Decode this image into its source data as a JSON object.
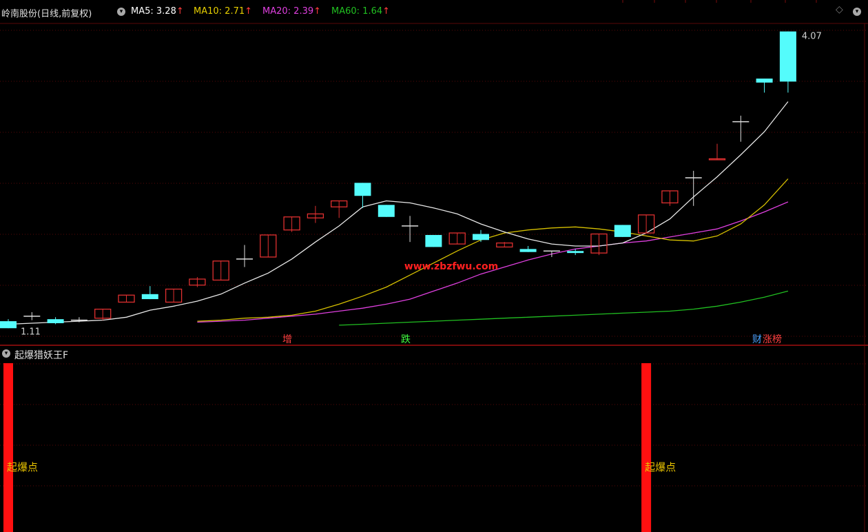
{
  "header": {
    "title": "岭南股份(日线,前复权)",
    "ma": [
      {
        "label": "MA5:",
        "value": "3.28",
        "color": "#ffffff"
      },
      {
        "label": "MA10:",
        "value": "2.71",
        "color": "#e8d000"
      },
      {
        "label": "MA20:",
        "value": "2.39",
        "color": "#e040e0"
      },
      {
        "label": "MA60:",
        "value": "1.64",
        "color": "#21c021"
      }
    ]
  },
  "price": {
    "high_label": "4.07",
    "low_label": "1.11",
    "watermark": "www.zbzfwu.com",
    "markers": [
      {
        "text": "增",
        "color": "#ff4040"
      },
      {
        "text": "跌",
        "color": "#40ff40"
      },
      {
        "text": "财",
        "color": "#4aa3ff"
      },
      {
        "text": "涨榜",
        "color": "#ff4040"
      }
    ]
  },
  "chart_data": {
    "type": "candlestick",
    "series_name": "岭南股份",
    "ylim": [
      1.05,
      4.15
    ],
    "candles": [
      {
        "o": 1.18,
        "h": 1.2,
        "l": 1.11,
        "c": 1.11
      },
      {
        "o": 1.23,
        "h": 1.27,
        "l": 1.19,
        "c": 1.23
      },
      {
        "o": 1.2,
        "h": 1.22,
        "l": 1.15,
        "c": 1.16
      },
      {
        "o": 1.19,
        "h": 1.22,
        "l": 1.17,
        "c": 1.19
      },
      {
        "o": 1.21,
        "h": 1.3,
        "l": 1.19,
        "c": 1.3
      },
      {
        "o": 1.37,
        "h": 1.44,
        "l": 1.37,
        "c": 1.44
      },
      {
        "o": 1.45,
        "h": 1.53,
        "l": 1.4,
        "c": 1.4
      },
      {
        "o": 1.37,
        "h": 1.5,
        "l": 1.37,
        "c": 1.5
      },
      {
        "o": 1.54,
        "h": 1.62,
        "l": 1.52,
        "c": 1.6
      },
      {
        "o": 1.59,
        "h": 1.78,
        "l": 1.59,
        "c": 1.78
      },
      {
        "o": 1.8,
        "h": 1.94,
        "l": 1.72,
        "c": 1.8
      },
      {
        "o": 1.82,
        "h": 2.04,
        "l": 1.82,
        "c": 2.04
      },
      {
        "o": 2.09,
        "h": 2.22,
        "l": 2.07,
        "c": 2.22
      },
      {
        "o": 2.21,
        "h": 2.33,
        "l": 2.16,
        "c": 2.25
      },
      {
        "o": 2.32,
        "h": 2.38,
        "l": 2.21,
        "c": 2.38
      },
      {
        "o": 2.56,
        "h": 2.56,
        "l": 2.31,
        "c": 2.43
      },
      {
        "o": 2.34,
        "h": 2.34,
        "l": 2.22,
        "c": 2.22
      },
      {
        "o": 2.13,
        "h": 2.23,
        "l": 1.97,
        "c": 2.13
      },
      {
        "o": 2.04,
        "h": 2.04,
        "l": 1.92,
        "c": 1.92
      },
      {
        "o": 1.95,
        "h": 2.06,
        "l": 1.95,
        "c": 2.06
      },
      {
        "o": 2.05,
        "h": 2.09,
        "l": 1.97,
        "c": 1.99
      },
      {
        "o": 1.92,
        "h": 1.97,
        "l": 1.92,
        "c": 1.96
      },
      {
        "o": 1.9,
        "h": 1.93,
        "l": 1.87,
        "c": 1.87
      },
      {
        "o": 1.88,
        "h": 1.88,
        "l": 1.82,
        "c": 1.88
      },
      {
        "o": 1.88,
        "h": 1.9,
        "l": 1.84,
        "c": 1.86
      },
      {
        "o": 1.86,
        "h": 2.05,
        "l": 1.84,
        "c": 2.05
      },
      {
        "o": 2.14,
        "h": 2.14,
        "l": 2.02,
        "c": 2.02
      },
      {
        "o": 2.06,
        "h": 2.24,
        "l": 2.06,
        "c": 2.24
      },
      {
        "o": 2.36,
        "h": 2.48,
        "l": 2.33,
        "c": 2.48
      },
      {
        "o": 2.61,
        "h": 2.68,
        "l": 2.33,
        "c": 2.61
      },
      {
        "o": 2.79,
        "h": 2.95,
        "l": 2.79,
        "c": 2.8
      },
      {
        "o": 3.17,
        "h": 3.23,
        "l": 2.97,
        "c": 3.17
      },
      {
        "o": 3.6,
        "h": 3.6,
        "l": 3.46,
        "c": 3.56
      },
      {
        "o": 4.07,
        "h": 4.07,
        "l": 3.46,
        "c": 3.57
      }
    ],
    "ma5": [
      1.15,
      1.16,
      1.17,
      1.18,
      1.19,
      1.22,
      1.29,
      1.33,
      1.38,
      1.45,
      1.56,
      1.66,
      1.8,
      1.97,
      2.13,
      2.32,
      2.38,
      2.36,
      2.31,
      2.25,
      2.15,
      2.07,
      2.0,
      1.95,
      1.93,
      1.93,
      1.96,
      2.06,
      2.2,
      2.42,
      2.62,
      2.84,
      3.07,
      3.37
    ],
    "ma10": [
      1.18,
      1.19,
      1.21,
      1.22,
      1.24,
      1.28,
      1.35,
      1.43,
      1.52,
      1.64,
      1.76,
      1.88,
      1.99,
      2.06,
      2.09,
      2.11,
      2.12,
      2.1,
      2.07,
      2.03,
      1.99,
      1.98,
      2.03,
      2.15,
      2.34,
      2.6
    ],
    "ma20": [
      1.17,
      1.18,
      1.19,
      1.21,
      1.23,
      1.25,
      1.28,
      1.31,
      1.35,
      1.4,
      1.48,
      1.56,
      1.65,
      1.72,
      1.79,
      1.85,
      1.9,
      1.93,
      1.96,
      1.98,
      2.02,
      2.06,
      2.1,
      2.18,
      2.27,
      2.37
    ],
    "ma60": [
      1.14,
      1.15,
      1.16,
      1.17,
      1.18,
      1.19,
      1.2,
      1.21,
      1.22,
      1.23,
      1.24,
      1.25,
      1.26,
      1.27,
      1.28,
      1.3,
      1.33,
      1.37,
      1.42,
      1.48
    ]
  },
  "indicator": {
    "title": "起爆猎妖王F",
    "signal_label": "起爆点",
    "signals": [
      {
        "candle_index": 0,
        "label": "起爆点"
      },
      {
        "candle_index": 27,
        "label": "起爆点"
      }
    ]
  }
}
